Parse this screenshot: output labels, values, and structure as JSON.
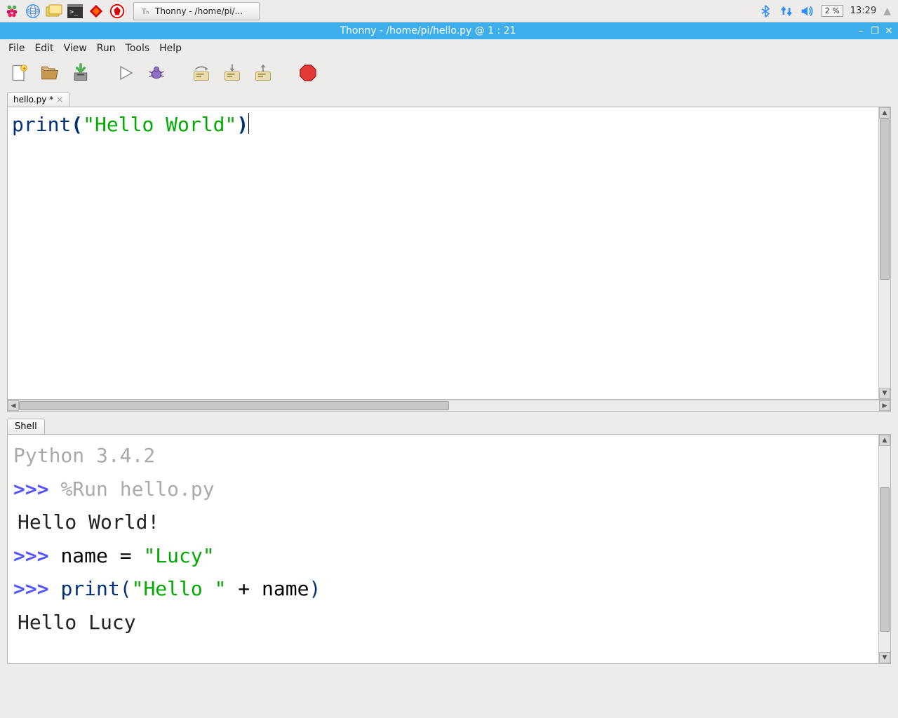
{
  "os": {
    "taskbar_task": "Thonny  -  /home/pi/...",
    "cpu": "2 %",
    "clock": "13:29"
  },
  "window": {
    "title": "Thonny  -  /home/pi/hello.py  @  1 : 21"
  },
  "menu": {
    "file": "File",
    "edit": "Edit",
    "view": "View",
    "run": "Run",
    "tools": "Tools",
    "help": "Help"
  },
  "editor": {
    "tab_label": "hello.py *",
    "code": {
      "fn": "print",
      "open": "(",
      "string": "\"Hello World\"",
      "close": ")"
    }
  },
  "shell": {
    "tab": "Shell",
    "version": "Python 3.4.2",
    "prompt": ">>> ",
    "run_cmd": "%Run hello.py",
    "output1": "Hello World!",
    "line2_code": "name = ",
    "line2_str": "\"Lucy\"",
    "line3_fn": "print",
    "line3_open": "(",
    "line3_str": "\"Hello \"",
    "line3_rest": " + name",
    "line3_close": ")",
    "output2": "Hello Lucy"
  }
}
